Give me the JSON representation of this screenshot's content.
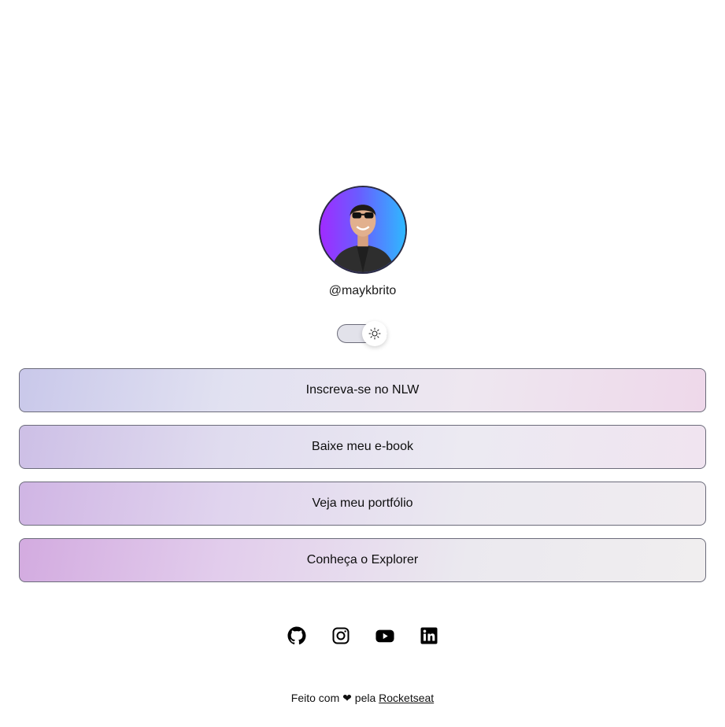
{
  "profile": {
    "username": "@maykbrito",
    "avatar_alt": "Mayk Brito"
  },
  "theme_switch": {
    "state": "light",
    "icon": "sun-icon"
  },
  "links": [
    {
      "label": "Inscreva-se no NLW"
    },
    {
      "label": "Baixe meu e-book"
    },
    {
      "label": "Veja meu portfólio"
    },
    {
      "label": "Conheça o Explorer"
    }
  ],
  "social": [
    {
      "icon": "github-icon"
    },
    {
      "icon": "instagram-icon"
    },
    {
      "icon": "youtube-icon"
    },
    {
      "icon": "linkedin-icon"
    }
  ],
  "footer": {
    "prefix": "Feito com",
    "heart": "❤",
    "middle": "pela",
    "link_label": "Rocketseat"
  },
  "colors": {
    "text": "#000000",
    "border": "#6b6b7a",
    "avatar_gradient_start": "#a02bff",
    "avatar_gradient_end": "#2fb8ff"
  }
}
